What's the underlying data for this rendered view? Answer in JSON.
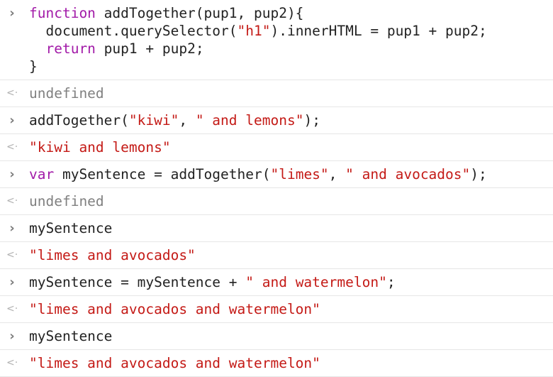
{
  "colors": {
    "keyword": "#a21aa8",
    "string": "#c41a16",
    "plain": "#222222",
    "undefined": "#808080",
    "prompt": "#7a7a7a",
    "result_arrow": "#b0b0b0",
    "divider": "#e6e6e6"
  },
  "icons": {
    "prompt": "chevron-right-icon",
    "result": "return-arrow-icon"
  },
  "glyphs": {
    "prompt": "›",
    "result": "<·"
  },
  "entries": [
    {
      "input_lines": [
        [
          {
            "t": "kw",
            "v": "function"
          },
          {
            "t": "pl",
            "v": " addTogether(pup1, pup2){"
          }
        ],
        [
          {
            "t": "pl",
            "v": "  document.querySelector("
          },
          {
            "t": "str",
            "v": "\"h1\""
          },
          {
            "t": "pl",
            "v": ").innerHTML = pup1 + pup2;"
          }
        ],
        [
          {
            "t": "pl",
            "v": "  "
          },
          {
            "t": "kw",
            "v": "return"
          },
          {
            "t": "pl",
            "v": " pup1 + pup2;"
          }
        ],
        [
          {
            "t": "pl",
            "v": "}"
          }
        ]
      ],
      "output": [
        {
          "t": "undef",
          "v": "undefined"
        }
      ]
    },
    {
      "input_lines": [
        [
          {
            "t": "pl",
            "v": "addTogether("
          },
          {
            "t": "str",
            "v": "\"kiwi\""
          },
          {
            "t": "pl",
            "v": ", "
          },
          {
            "t": "str",
            "v": "\" and lemons\""
          },
          {
            "t": "pl",
            "v": ");"
          }
        ]
      ],
      "output": [
        {
          "t": "str",
          "v": "\"kiwi and lemons\""
        }
      ]
    },
    {
      "input_lines": [
        [
          {
            "t": "kw",
            "v": "var"
          },
          {
            "t": "pl",
            "v": " mySentence = addTogether("
          },
          {
            "t": "str",
            "v": "\"limes\""
          },
          {
            "t": "pl",
            "v": ", "
          },
          {
            "t": "str",
            "v": "\" and avocados\""
          },
          {
            "t": "pl",
            "v": ");"
          }
        ]
      ],
      "output": [
        {
          "t": "undef",
          "v": "undefined"
        }
      ]
    },
    {
      "input_lines": [
        [
          {
            "t": "pl",
            "v": "mySentence"
          }
        ]
      ],
      "output": [
        {
          "t": "str",
          "v": "\"limes and avocados\""
        }
      ]
    },
    {
      "input_lines": [
        [
          {
            "t": "pl",
            "v": "mySentence = mySentence + "
          },
          {
            "t": "str",
            "v": "\" and watermelon\""
          },
          {
            "t": "pl",
            "v": ";"
          }
        ]
      ],
      "output": [
        {
          "t": "str",
          "v": "\"limes and avocados and watermelon\""
        }
      ]
    },
    {
      "input_lines": [
        [
          {
            "t": "pl",
            "v": "mySentence"
          }
        ]
      ],
      "output": [
        {
          "t": "str",
          "v": "\"limes and avocados and watermelon\""
        }
      ]
    }
  ]
}
